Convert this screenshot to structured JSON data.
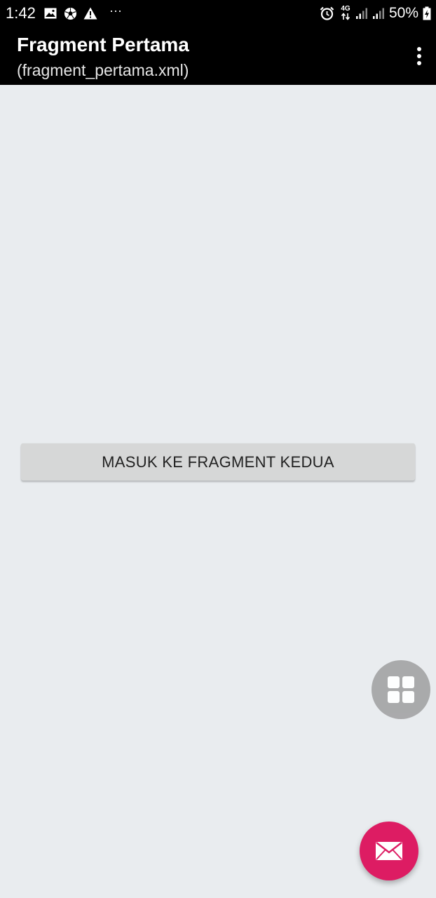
{
  "status_bar": {
    "time": "1:42",
    "network_type": "4G",
    "battery_percent": "50%",
    "more_indicator": "···",
    "icons": [
      "image-notification-icon",
      "soccer-ball-icon",
      "warning-icon",
      "alarm-icon",
      "data-arrows-icon",
      "signal-icon",
      "battery-charging-icon"
    ]
  },
  "app_bar": {
    "title": "Fragment Pertama",
    "subtitle": "(fragment_pertama.xml)",
    "overflow_icon": "more-vert-icon"
  },
  "main": {
    "button_label": "MASUK KE FRAGMENT KEDUA"
  },
  "fabs": {
    "grid_icon": "grid-icon",
    "mail_icon": "mail-icon",
    "mail_color": "#dd1c63",
    "grid_color": "#a6a7a8"
  },
  "colors": {
    "app_bar": "#000000",
    "background": "#e9ecef",
    "button": "#d6d7d7"
  }
}
